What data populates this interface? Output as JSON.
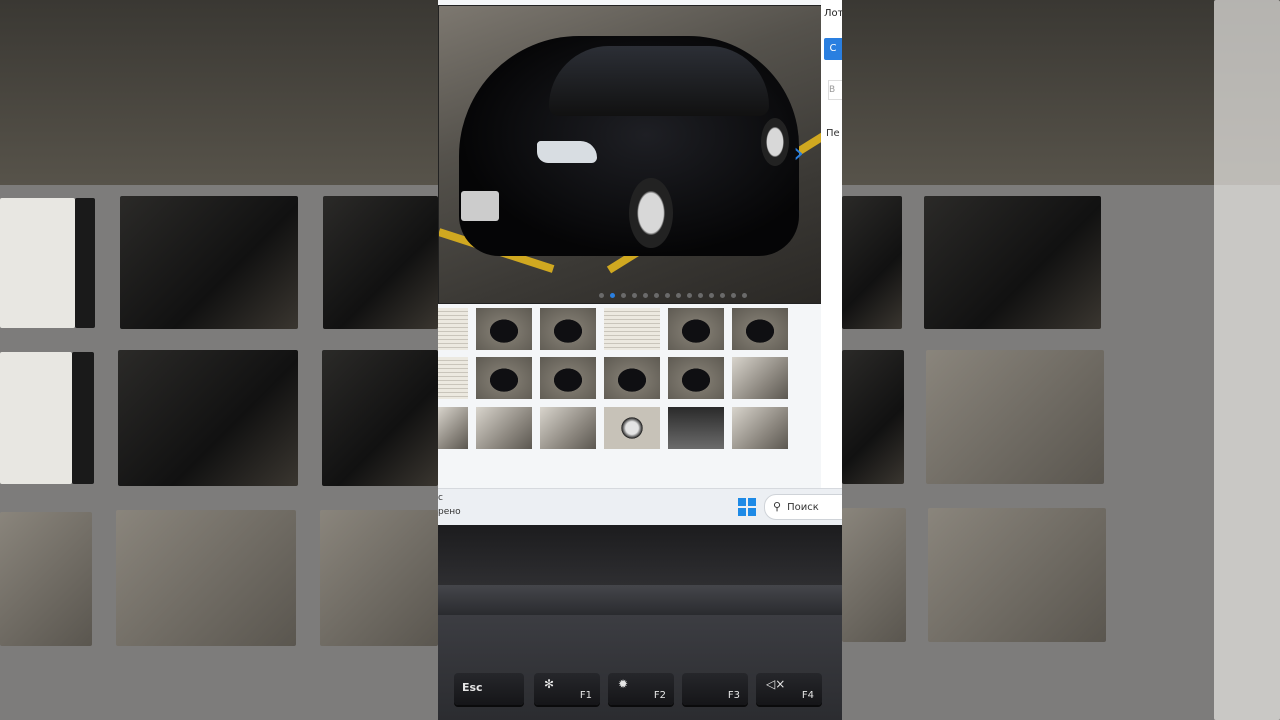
{
  "listing_side": {
    "title_fragment": "Лот",
    "button_fragment": "С",
    "input_fragment": "В",
    "label_fragment": "Пе"
  },
  "carousel": {
    "next_arrow": "›",
    "dot_count": 14,
    "active_dot": 1
  },
  "taskbar": {
    "line1": "с",
    "line2": "рено",
    "search_placeholder": "Поиск",
    "search_icon": "search-icon",
    "start_icon": "windows-logo-icon"
  },
  "keyboard": {
    "keys": [
      {
        "label": "Esc",
        "sub": ""
      },
      {
        "label": "✻",
        "sub": "F1"
      },
      {
        "label": "✹",
        "sub": "F2"
      },
      {
        "label": "",
        "sub": "F3"
      },
      {
        "label": "◁×",
        "sub": "F4"
      }
    ]
  },
  "colors": {
    "accent": "#2a7fe0",
    "floor_line": "#d0a820"
  }
}
